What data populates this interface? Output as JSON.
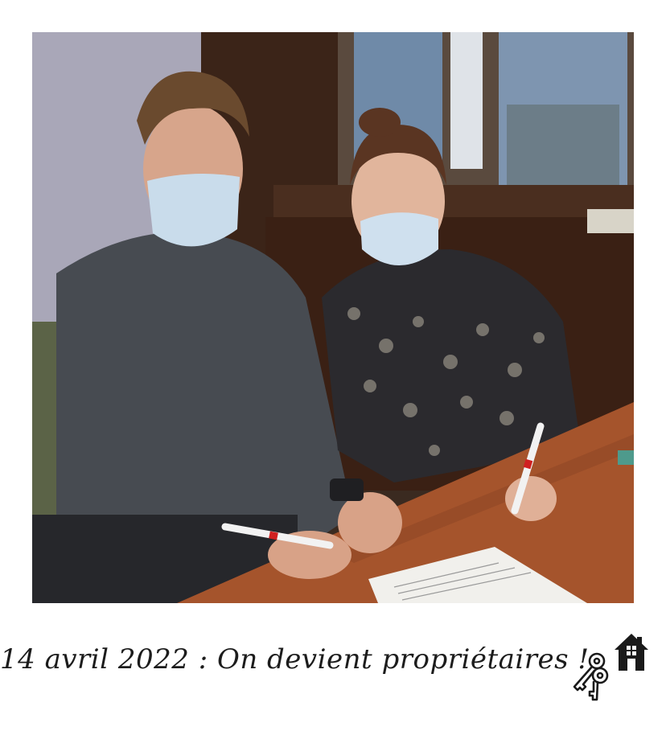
{
  "caption": {
    "text": "14 avril 2022 : On devient propriétaires !"
  },
  "icons": {
    "keys": "keys-icon",
    "house": "house-icon"
  },
  "colors": {
    "frame": "#ffffff",
    "caption_text": "#1c1c1c",
    "icon": "#1a1a1a"
  }
}
